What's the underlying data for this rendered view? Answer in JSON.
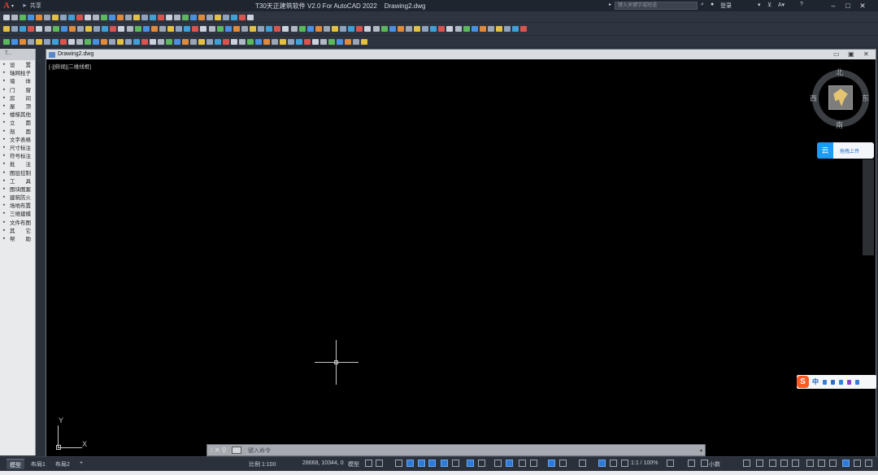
{
  "app": {
    "logo": "A",
    "share_label": "共享",
    "title": "T30天正建筑软件 V2.0 For AutoCAD 2022    Drawing2.dwg",
    "search_placeholder": "键入关键字或短语",
    "login_label": "登录",
    "help_label": "?"
  },
  "palette": {
    "header": "T...",
    "items": [
      "设　　置",
      "轴网柱子",
      "墙　　体",
      "门　　窗",
      "房　　间",
      "屋　　顶",
      "楼梯其他",
      "立　　面",
      "剖　　面",
      "文字表格",
      "尺寸标注",
      "符号标注",
      "批　　注",
      "图层控制",
      "工　　具",
      "图块图案",
      "建筑防火",
      "场地布置",
      "三维建模",
      "文件布图",
      "其　　它",
      "帮　　助"
    ]
  },
  "document": {
    "tab_name": "Drawing2.dwg",
    "view_label": "[-][俯视][二维线框]"
  },
  "viewcube": {
    "north": "北",
    "south": "南",
    "east": "东",
    "west": "西"
  },
  "cloud_upload": {
    "label": "拖拽上传"
  },
  "ucs": {
    "x_label": "X",
    "y_label": "Y"
  },
  "command_line": {
    "placeholder": "键入命令"
  },
  "ime": {
    "logo": "S",
    "mode": "中"
  },
  "layout_tabs": [
    "模型",
    "布局1",
    "布局2"
  ],
  "add_tab": "+",
  "status": {
    "scale": "比例 1:100",
    "coordinates": "28668, 10344, 0",
    "model_label": "模型",
    "annotation_scale": "1:1 / 100%",
    "decimal_label": "小数"
  },
  "colors": {
    "accent": "#2f7ad6",
    "background": "#2b313b",
    "canvas": "#000000"
  }
}
